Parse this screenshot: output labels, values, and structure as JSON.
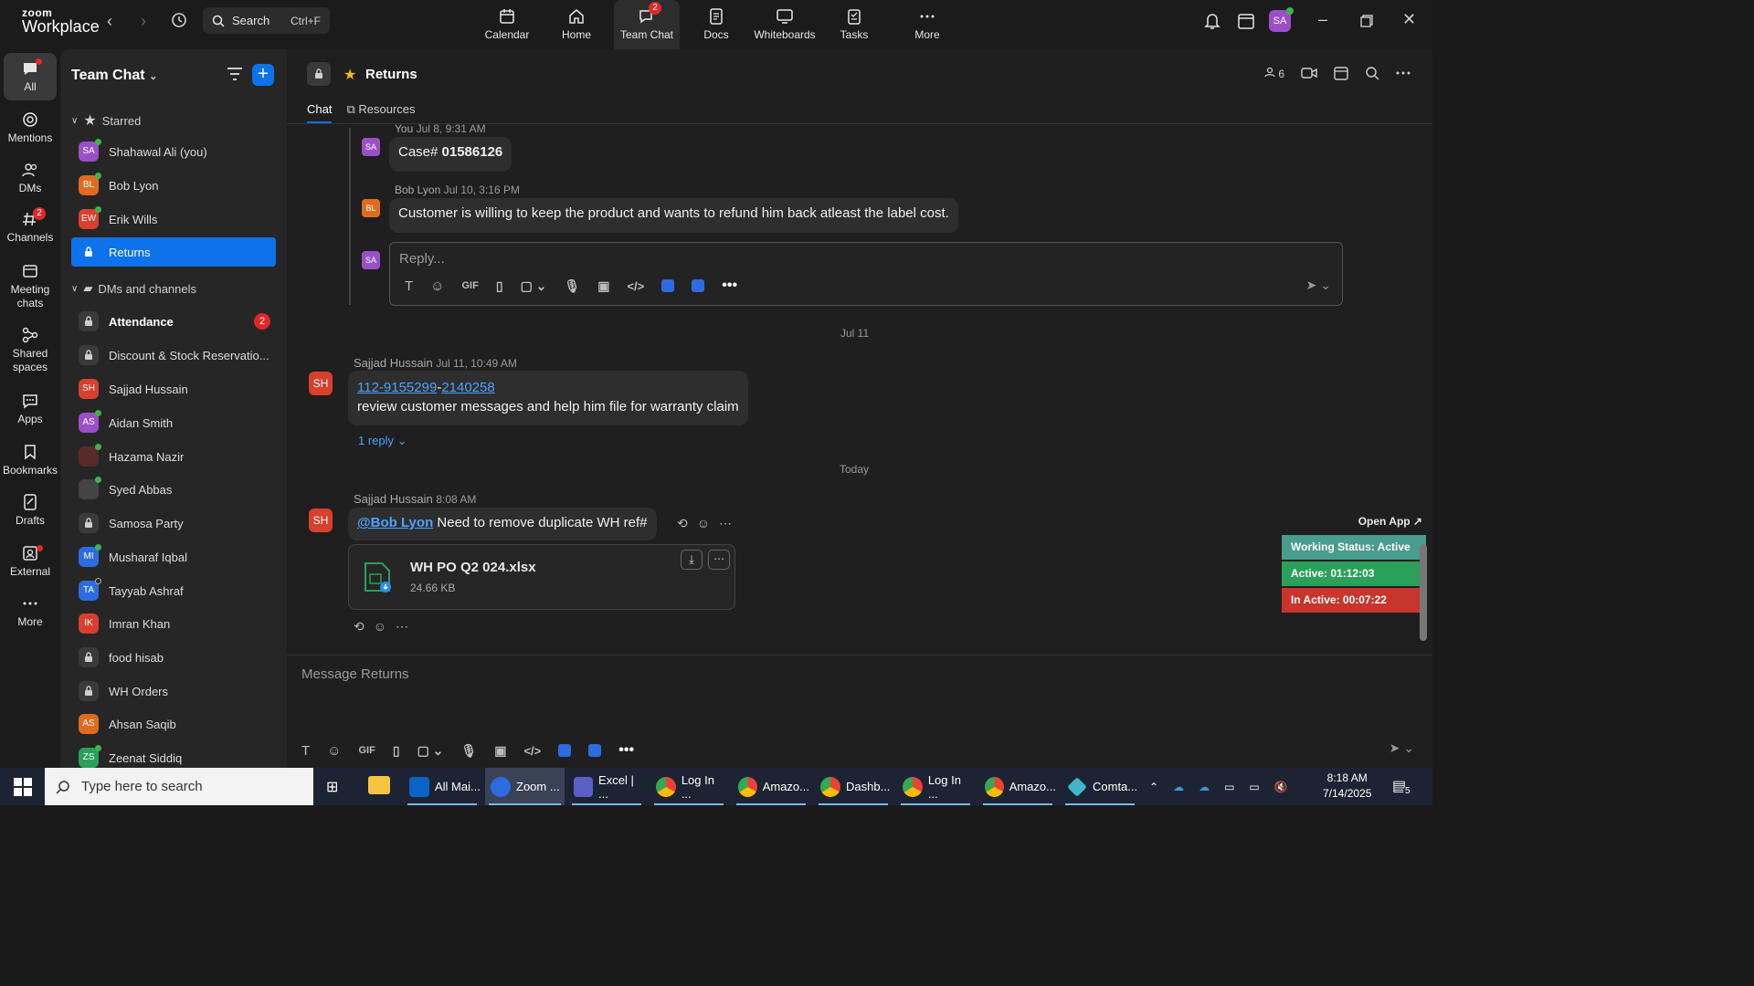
{
  "app": {
    "logo_top": "zoom",
    "logo_bottom": "Workplace"
  },
  "search": {
    "label": "Search",
    "shortcut": "Ctrl+F"
  },
  "top_nav": [
    {
      "label": "Calendar"
    },
    {
      "label": "Home"
    },
    {
      "label": "Team Chat",
      "badge": "2"
    },
    {
      "label": "Docs"
    },
    {
      "label": "Whiteboards"
    },
    {
      "label": "Tasks"
    },
    {
      "label": "More"
    }
  ],
  "user_avatar": "SA",
  "rail": [
    {
      "label": "All"
    },
    {
      "label": "Mentions"
    },
    {
      "label": "DMs"
    },
    {
      "label": "Channels",
      "badge": "2"
    },
    {
      "label": "Meeting chats"
    },
    {
      "label": "Shared spaces"
    },
    {
      "label": "Apps"
    },
    {
      "label": "Bookmarks"
    },
    {
      "label": "Drafts"
    },
    {
      "label": "External"
    },
    {
      "label": "More"
    }
  ],
  "sidebar": {
    "title": "Team Chat",
    "starred_label": "Starred",
    "dms_label": "DMs and channels",
    "starred": [
      {
        "initials": "SA",
        "name": "Shahawal Ali (you)",
        "color": "#9b4fc7"
      },
      {
        "initials": "BL",
        "name": "Bob Lyon",
        "color": "#e06b1f"
      },
      {
        "initials": "EW",
        "name": "Erik Wills",
        "color": "#d8402d"
      },
      {
        "initials": "",
        "name": "Returns",
        "color": ""
      }
    ],
    "channels": [
      {
        "initials": "",
        "name": "Attendance",
        "count": "2"
      },
      {
        "initials": "",
        "name": "Discount & Stock Reservatio..."
      },
      {
        "initials": "SH",
        "name": "Sajjad Hussain",
        "color": "#d8402d"
      },
      {
        "initials": "AS",
        "name": "Aidan Smith",
        "color": "#9b4fc7"
      },
      {
        "initials": "",
        "name": "Hazama Nazir",
        "color": "#5a2a2a"
      },
      {
        "initials": "",
        "name": "Syed Abbas",
        "color": "#333333"
      },
      {
        "initials": "",
        "name": "Samosa Party"
      },
      {
        "initials": "MI",
        "name": "Musharaf Iqbal",
        "color": "#2d6cdf"
      },
      {
        "initials": "TA",
        "name": "Tayyab Ashraf",
        "color": "#2d6cdf"
      },
      {
        "initials": "IK",
        "name": "Imran Khan",
        "color": "#d8402d"
      },
      {
        "initials": "",
        "name": "food hisab"
      },
      {
        "initials": "",
        "name": "WH Orders"
      },
      {
        "initials": "AS",
        "name": "Ahsan Saqib",
        "color": "#e06b1f"
      },
      {
        "initials": "ZS",
        "name": "Zeenat Siddiq",
        "color": "#2aa05a"
      }
    ]
  },
  "channel": {
    "title": "Returns",
    "tabs": [
      "Chat",
      "Resources"
    ],
    "member_count": "6"
  },
  "messages": {
    "m1": {
      "author": "You",
      "time": "Jul 8, 9:31 AM",
      "initials": "SA",
      "prefix": "Case# ",
      "bold": "01586126"
    },
    "m2": {
      "author": "Bob Lyon",
      "time": "Jul 10, 3:16 PM",
      "initials": "BL",
      "text": "Customer is willing to keep the product and wants to refund him back atleast the label cost."
    },
    "reply_placeholder": "Reply...",
    "date1": "Jul 11",
    "m3": {
      "author": "Sajjad Hussain",
      "time": "Jul 11, 10:49 AM",
      "initials": "SH",
      "link1": "112-9155299",
      "dash": "-",
      "link2": "2140258",
      "text": "review customer messages and help him file for warranty claim",
      "replies": "1 reply"
    },
    "date2": "Today",
    "m4": {
      "author": "Sajjad Hussain",
      "time": "8:08 AM",
      "initials": "SH",
      "mention": "@Bob Lyon",
      "text": " Need to remove duplicate WH ref#"
    },
    "file": {
      "name": "WH PO Q2 024.xlsx",
      "size": "24.66 KB"
    }
  },
  "compose": {
    "placeholder": "Message Returns"
  },
  "toolbar": {
    "gif": "GIF"
  },
  "widget": {
    "open_app": "Open App ↗",
    "status": "Working Status: Active",
    "active": "Active: 01:12:03",
    "inactive": "In Active: 00:07:22"
  },
  "taskbar": {
    "search": "Type here to search",
    "apps": [
      "All Mai...",
      "Zoom ...",
      "Excel | ...",
      "Log In ...",
      "Amazo...",
      "Dashb...",
      "Log In ...",
      "Amazo...",
      "Comta..."
    ],
    "time": "8:18 AM",
    "date": "7/14/2025",
    "notifications": "5"
  }
}
